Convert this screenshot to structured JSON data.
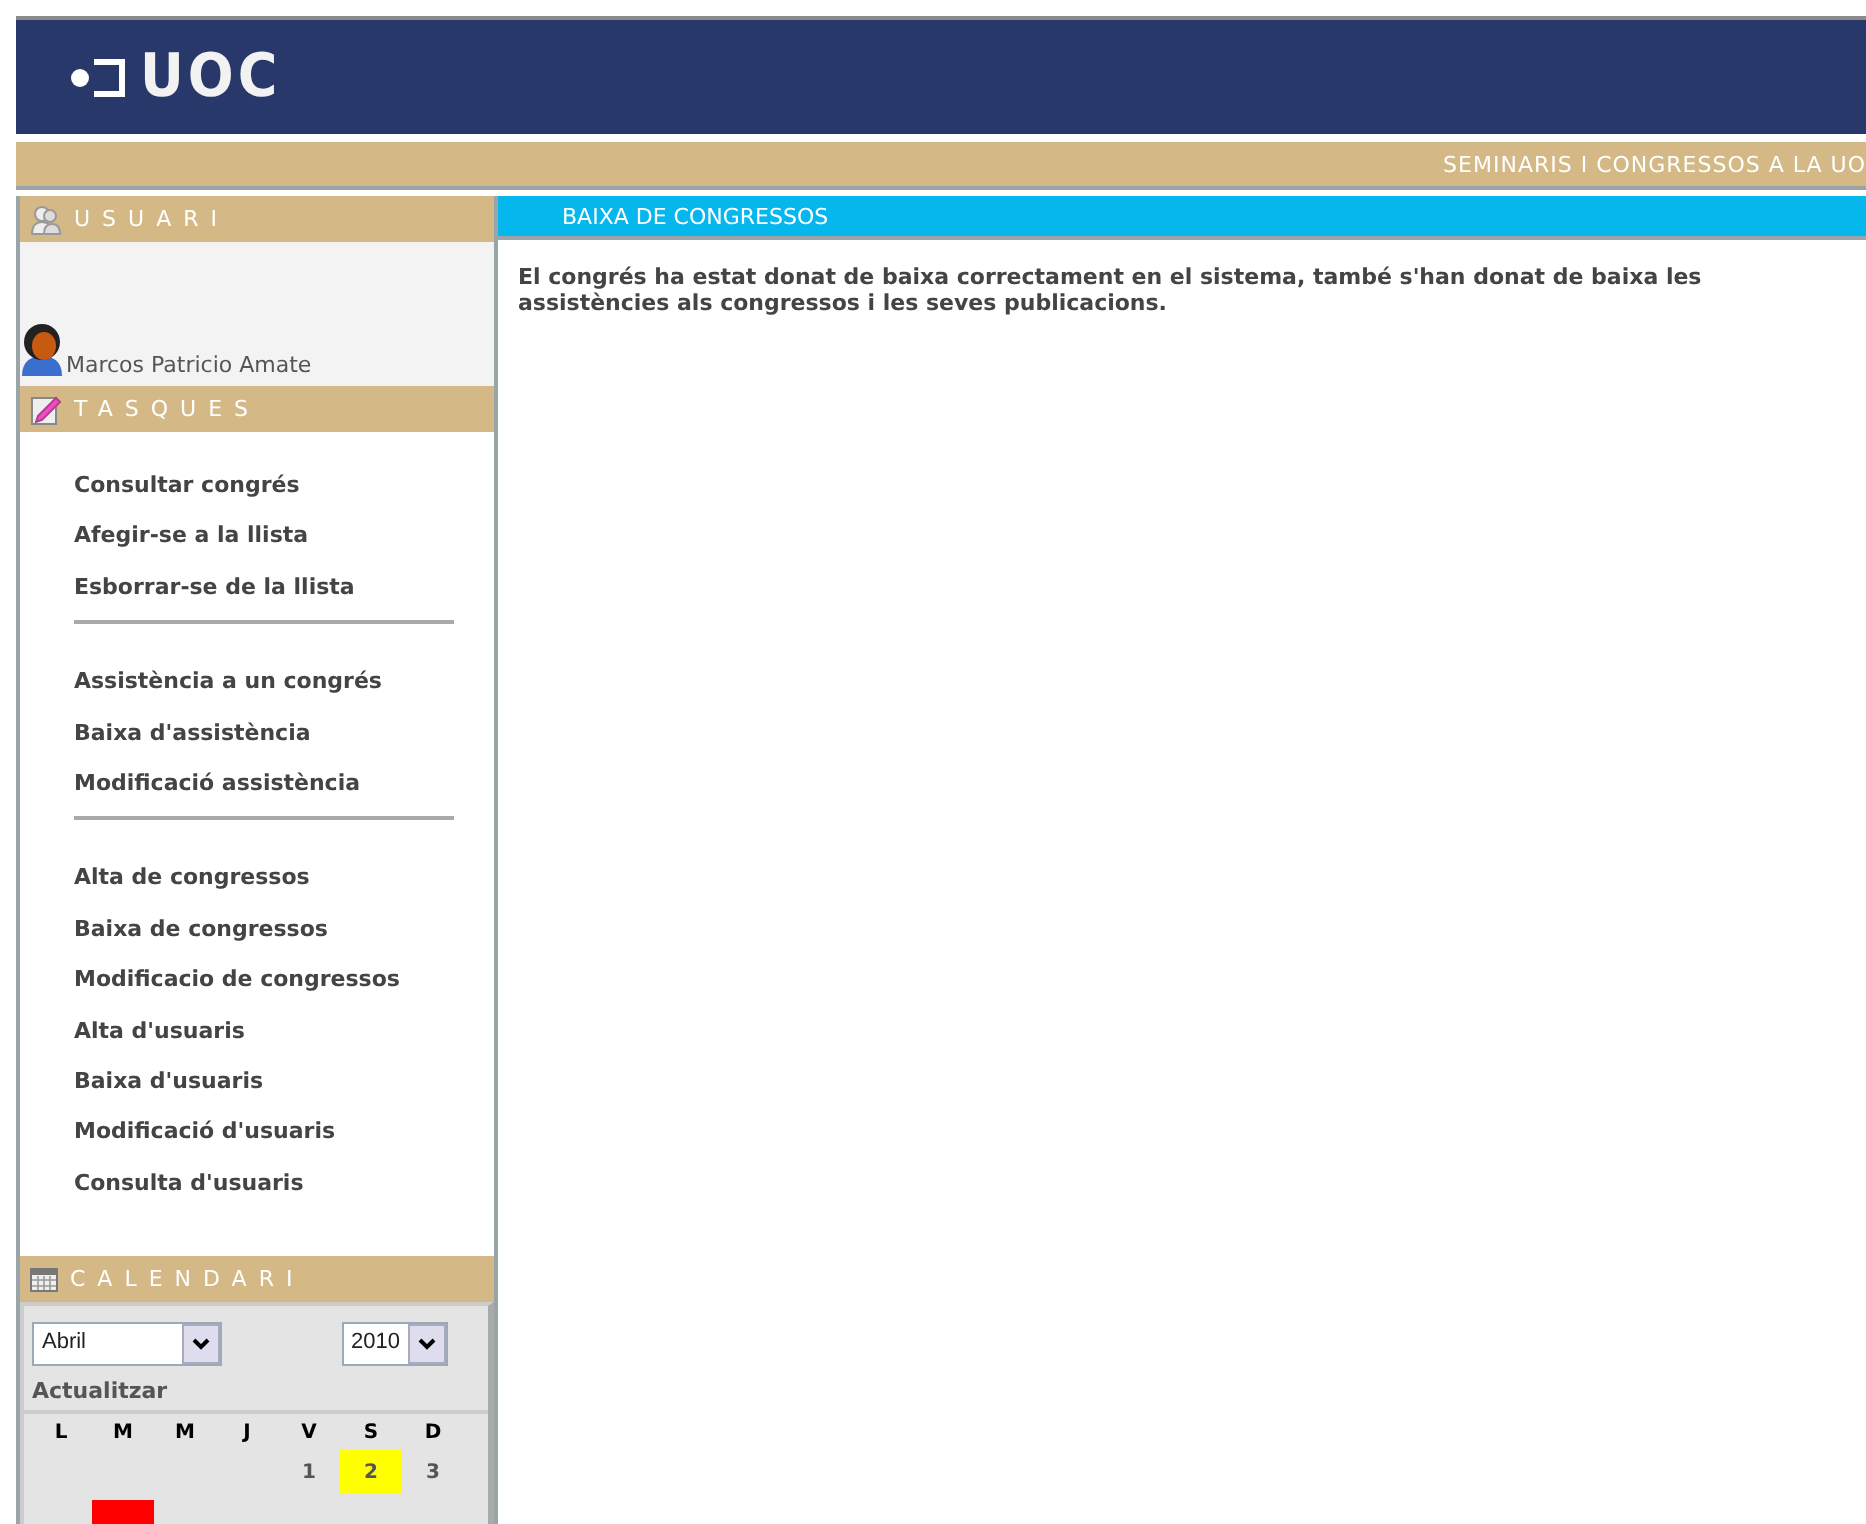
{
  "header": {
    "logo": "UOC"
  },
  "site_bar": {
    "title": "SEMINARIS I CONGRESSOS A LA UO"
  },
  "user_panel": {
    "title": "USUARI",
    "user_name": "Marcos Patricio Amate"
  },
  "tasks_panel": {
    "title": "TASQUES",
    "groups": [
      [
        "Consultar congrés",
        "Afegir-se a la llista",
        "Esborrar-se de la llista"
      ],
      [
        "Assistència a un congrés",
        "Baixa d'assistència",
        "Modificació assistència"
      ],
      [
        "Alta de congressos",
        "Baixa de congressos",
        "Modificacio de congressos",
        "Alta d'usuaris",
        "Baixa d'usuaris",
        "Modificació d'usuaris",
        "Consulta d'usuaris"
      ]
    ]
  },
  "calendar": {
    "title": "CALENDARI",
    "month": "Abril",
    "year": "2010",
    "update_link": "Actualitzar",
    "weekdays": [
      "L",
      "M",
      "M",
      "J",
      "V",
      "S",
      "D"
    ],
    "weeks": [
      [
        {
          "kind": "blank"
        },
        {
          "kind": "blank"
        },
        {
          "kind": "blank"
        },
        {
          "kind": "blank"
        },
        {
          "kind": "day",
          "label": "1"
        },
        {
          "kind": "day",
          "label": "2",
          "color": "#ffff00"
        },
        {
          "kind": "day",
          "label": "3"
        }
      ],
      [
        {
          "kind": "blank"
        },
        {
          "kind": "marked",
          "color": "#ff0000"
        }
      ]
    ]
  },
  "main": {
    "title": "BAIXA DE CONGRESSOS",
    "message": "El congrés ha estat donat de baixa correctament en el sistema, també s'han donat de baixa les assistències als congressos i les seves publicacions."
  }
}
